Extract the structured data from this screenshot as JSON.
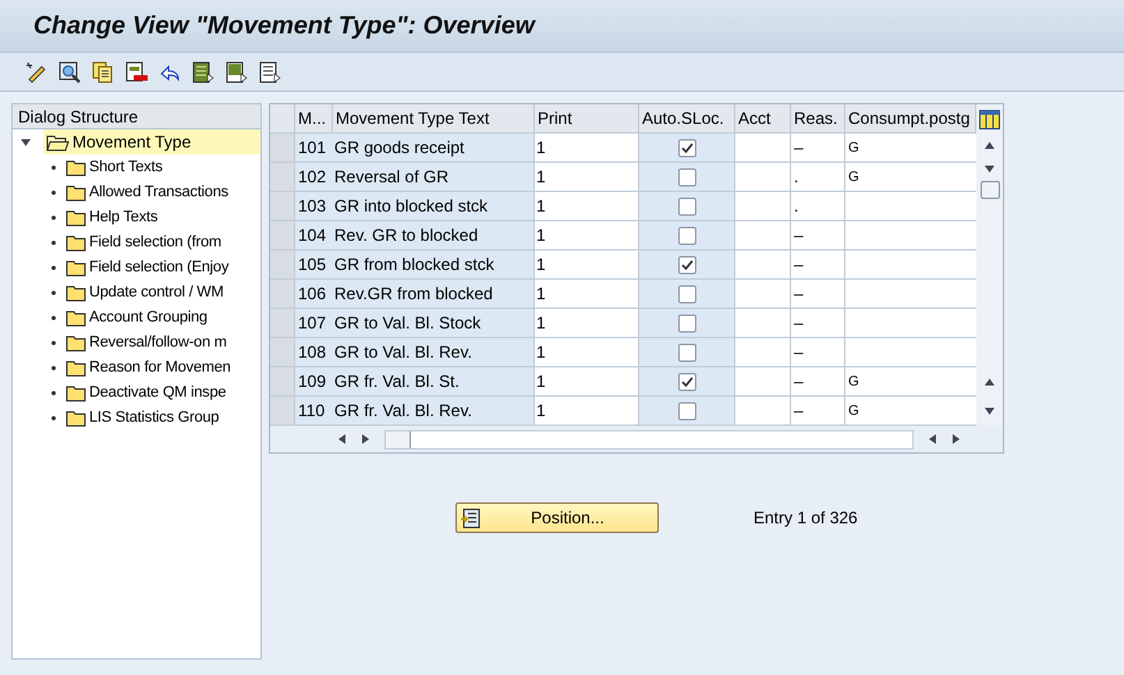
{
  "window": {
    "title": "Change View \"Movement Type\": Overview"
  },
  "toolbar": [
    {
      "kind": "pencil"
    },
    {
      "kind": "magnifier"
    },
    {
      "kind": "copy"
    },
    {
      "kind": "delete"
    },
    {
      "kind": "undo"
    },
    {
      "kind": "select-all"
    },
    {
      "kind": "select-block"
    },
    {
      "kind": "deselect"
    }
  ],
  "dialog_structure": {
    "title": "Dialog Structure",
    "items": [
      {
        "label": "Movement Type",
        "selected": true,
        "expanded": true,
        "children": [
          {
            "label": "Short Texts",
            "selected": false
          },
          {
            "label": "Allowed Transactions",
            "selected": false
          },
          {
            "label": "Help Texts",
            "selected": false
          },
          {
            "label": "Field selection (from",
            "selected": false
          },
          {
            "label": "Field selection (Enjoy",
            "selected": false
          },
          {
            "label": "Update control / WM",
            "selected": false
          },
          {
            "label": "Account Grouping",
            "selected": false
          },
          {
            "label": "Reversal/follow-on m",
            "selected": false
          },
          {
            "label": "Reason for Movemen",
            "selected": false
          },
          {
            "label": "Deactivate QM inspe",
            "selected": false
          },
          {
            "label": "LIS Statistics Group",
            "selected": false
          }
        ]
      }
    ]
  },
  "table": {
    "columns": [
      "M...",
      "Movement Type Text",
      "Print",
      "Auto.SLoc.",
      "Acct",
      "Reas.",
      "Consumpt.postg"
    ],
    "rows": [
      {
        "m": "101",
        "text": "GR goods receipt",
        "print": "1",
        "auto_sloc": true,
        "reas": "–",
        "consumpt": "G"
      },
      {
        "m": "102",
        "text": "Reversal of GR",
        "print": "1",
        "auto_sloc": false,
        "reas": ".",
        "consumpt": "G"
      },
      {
        "m": "103",
        "text": "GR into blocked stck",
        "print": "1",
        "auto_sloc": false,
        "reas": "."
      },
      {
        "m": "104",
        "text": "Rev. GR to blocked",
        "print": "1",
        "auto_sloc": false,
        "reas": "–"
      },
      {
        "m": "105",
        "text": "GR from blocked stck",
        "print": "1",
        "auto_sloc": true,
        "reas": "–"
      },
      {
        "m": "106",
        "text": "Rev.GR from blocked",
        "print": "1",
        "auto_sloc": false,
        "reas": "–"
      },
      {
        "m": "107",
        "text": "GR to Val. Bl. Stock",
        "print": "1",
        "auto_sloc": false,
        "reas": "–"
      },
      {
        "m": "108",
        "text": "GR to Val. Bl. Rev.",
        "print": "1",
        "auto_sloc": false,
        "reas": "–"
      },
      {
        "m": "109",
        "text": "GR fr. Val. Bl. St.",
        "print": "1",
        "auto_sloc": true,
        "reas": "–",
        "consumpt": "G"
      },
      {
        "m": "110",
        "text": "GR fr. Val. Bl. Rev.",
        "print": "1",
        "auto_sloc": false,
        "reas": "–",
        "consumpt": "G"
      }
    ]
  },
  "position_button": {
    "label": "Position..."
  },
  "entry_info": "Entry 1 of 326"
}
